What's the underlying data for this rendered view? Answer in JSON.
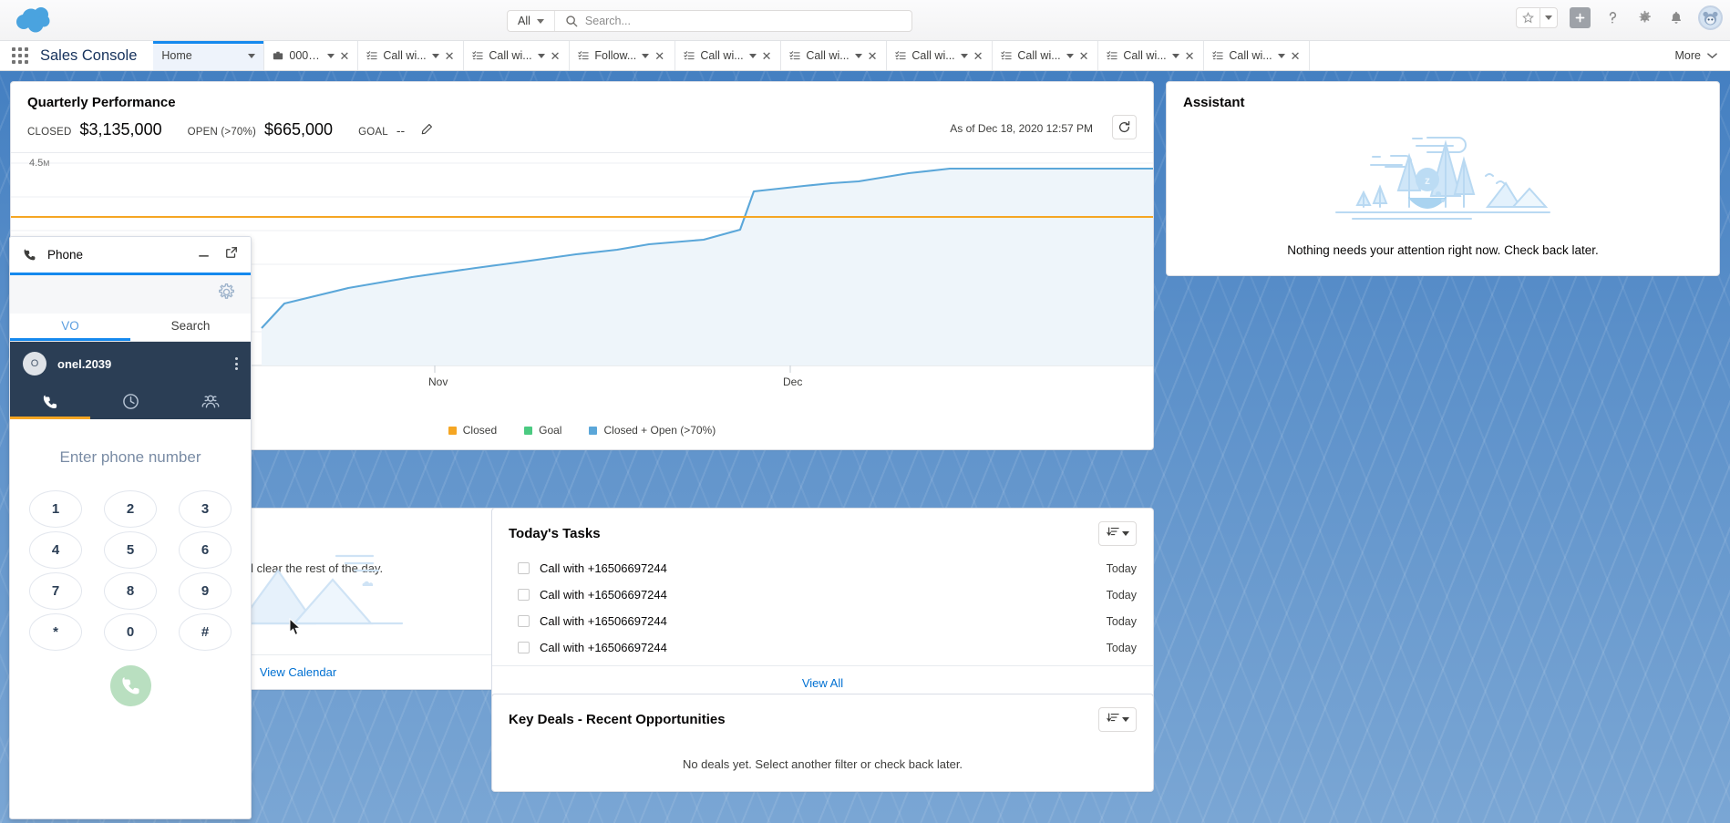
{
  "header": {
    "logo_icon": "salesforce-cloud-logo",
    "search": {
      "scope": "All",
      "placeholder": "Search...",
      "value": "",
      "icon": "search-icon"
    },
    "actions": [
      {
        "name": "favorites-star",
        "icon": "star-icon"
      },
      {
        "name": "favorites-dropdown",
        "icon": "chevron-down-icon"
      },
      {
        "name": "global-actions",
        "icon": "plus-icon"
      },
      {
        "name": "help",
        "icon": "question-mark-icon"
      },
      {
        "name": "setup",
        "icon": "gear-icon"
      },
      {
        "name": "notifications",
        "icon": "bell-icon"
      },
      {
        "name": "user-profile",
        "icon": "avatar-icon"
      }
    ]
  },
  "app": {
    "name": "Sales Console",
    "waffle_icon": "app-launcher-icon",
    "more_label": "More"
  },
  "tabs": [
    {
      "label": "Home",
      "icon": "",
      "active": true,
      "closable": false
    },
    {
      "label": "00001...",
      "icon": "opportunity-icon",
      "active": false,
      "closable": true
    },
    {
      "label": "Call wi...",
      "icon": "task-icon",
      "active": false,
      "closable": true
    },
    {
      "label": "Call wi...",
      "icon": "task-icon",
      "active": false,
      "closable": true
    },
    {
      "label": "Follow...",
      "icon": "task-icon",
      "active": false,
      "closable": true
    },
    {
      "label": "Call wi...",
      "icon": "task-icon",
      "active": false,
      "closable": true
    },
    {
      "label": "Call wi...",
      "icon": "task-icon",
      "active": false,
      "closable": true
    },
    {
      "label": "Call wi...",
      "icon": "task-icon",
      "active": false,
      "closable": true
    },
    {
      "label": "Call wi...",
      "icon": "task-icon",
      "active": false,
      "closable": true
    },
    {
      "label": "Call wi...",
      "icon": "task-icon",
      "active": false,
      "closable": true
    },
    {
      "label": "Call wi...",
      "icon": "task-icon",
      "active": false,
      "closable": true
    }
  ],
  "quarterly_performance": {
    "title": "Quarterly Performance",
    "as_of": "As of Dec 18, 2020 12:57 PM",
    "refresh_icon": "refresh-icon",
    "edit_goal_icon": "pencil-icon",
    "metrics": [
      {
        "label": "CLOSED",
        "value": "$3,135,000"
      },
      {
        "label": "OPEN (>70%)",
        "value": "$665,000"
      },
      {
        "label": "GOAL",
        "value": "--"
      }
    ]
  },
  "chart_data": {
    "type": "line",
    "title": "Quarterly Performance",
    "xlabel": "",
    "ylabel": "",
    "grid": true,
    "legend_position": "bottom",
    "x_tick_labels": [
      "Nov",
      "Dec"
    ],
    "y_tick_labels": [
      "4.5M"
    ],
    "ylim": [
      0,
      4500000
    ],
    "axis_note": "Y axis top gridline labeled 4.5M",
    "series": [
      {
        "name": "Closed",
        "color": "#f5a623",
        "type": "line",
        "note": "flat horizontal line at closed amount",
        "values": [
          3135000,
          3135000,
          3135000,
          3135000,
          3135000,
          3135000,
          3135000,
          3135000,
          3135000,
          3135000,
          3135000,
          3135000,
          3135000,
          3135000,
          3135000,
          3135000,
          3135000,
          3135000
        ]
      },
      {
        "name": "Goal",
        "color": "#4bca81",
        "type": "line",
        "note": "no goal set, series not plotted",
        "values": []
      },
      {
        "name": "Closed + Open (>70%)",
        "color": "#5ba7d9",
        "type": "area",
        "note": "cumulative step-up curve rising from ~1.05M to ~3.8M",
        "values": [
          1050000,
          1440000,
          1660000,
          1860000,
          2030000,
          2190000,
          2330000,
          2430000,
          2490000,
          2560000,
          2700000,
          3270000,
          3420000,
          3480000,
          3540000,
          3680000,
          3800000,
          3800000
        ]
      }
    ],
    "legend": [
      {
        "label": "Closed",
        "color": "#f5a623"
      },
      {
        "label": "Goal",
        "color": "#4bca81"
      },
      {
        "label": "Closed + Open (>70%)",
        "color": "#5ba7d9"
      }
    ]
  },
  "calendar_card": {
    "message": "ree and clear the rest of the day.",
    "link": "View Calendar"
  },
  "todays_tasks": {
    "title": "Today's Tasks",
    "sort_icon": "sort-icon",
    "caret_icon": "chevron-down-icon",
    "rows": [
      {
        "label": "Call with +16506697244",
        "due": "Today"
      },
      {
        "label": "Call with +16506697244",
        "due": "Today"
      },
      {
        "label": "Call with +16506697244",
        "due": "Today"
      },
      {
        "label": "Call with +16506697244",
        "due": "Today"
      }
    ],
    "view_all": "View All"
  },
  "key_deals": {
    "title": "Key Deals - Recent Opportunities",
    "sort_icon": "sort-icon",
    "caret_icon": "chevron-down-icon",
    "empty": "No deals yet. Select another filter or check back later."
  },
  "assistant": {
    "title": "Assistant",
    "message": "Nothing needs your attention right now. Check back later.",
    "illustration": "hammock-camping-illustration"
  },
  "softphone": {
    "title": "Phone",
    "phone_icon": "phone-icon",
    "minimize_icon": "minimize-icon",
    "popout_icon": "pop-out-icon",
    "gear_icon": "gear-icon",
    "tabs": [
      {
        "label": "VO",
        "active": true
      },
      {
        "label": "Search",
        "active": false
      }
    ],
    "user": {
      "initial": "O",
      "name": "onel.2039",
      "menu_icon": "kebab-menu-icon"
    },
    "dark_tabs": [
      {
        "name": "dialpad-tab",
        "icon": "phone-icon",
        "active": true
      },
      {
        "name": "history-tab",
        "icon": "clock-icon",
        "active": false
      },
      {
        "name": "contacts-tab",
        "icon": "people-icon",
        "active": false
      }
    ],
    "input_placeholder": "Enter phone number",
    "input_value": "",
    "keys": [
      "1",
      "2",
      "3",
      "4",
      "5",
      "6",
      "7",
      "8",
      "9",
      "*",
      "0",
      "#"
    ],
    "call_button_icon": "phone-call-icon"
  },
  "colors": {
    "brand_blue": "#1589ee",
    "link_blue": "#0070d2",
    "closed_orange": "#f5a623",
    "goal_green": "#4bca81",
    "open_blue": "#5ba7d9",
    "softphone_dark": "#2b3e55",
    "call_green": "#b9dfc0"
  }
}
